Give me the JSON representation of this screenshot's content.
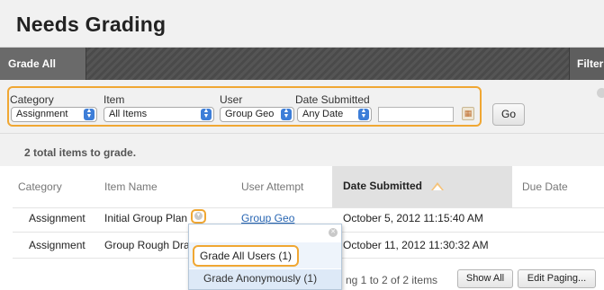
{
  "page": {
    "title": "Needs Grading"
  },
  "action_bar": {
    "grade_all": "Grade All",
    "filter": "Filter"
  },
  "filters": {
    "category": {
      "label": "Category",
      "value": "Assignment"
    },
    "item": {
      "label": "Item",
      "value": "All Items"
    },
    "user": {
      "label": "User",
      "value": "Group Geo"
    },
    "date_submitted": {
      "label": "Date Submitted",
      "value": "Any Date"
    },
    "go": "Go"
  },
  "summary": "2 total items to grade.",
  "table": {
    "headers": [
      "Category",
      "Item Name",
      "User Attempt",
      "Date Submitted",
      "Due Date"
    ],
    "rows": [
      {
        "category": "Assignment",
        "item_name": "Initial Group Plan",
        "user_attempt": "Group Geo",
        "date_submitted": "October 5, 2012 11:15:40 AM"
      },
      {
        "category": "Assignment",
        "item_name": "Group Rough Draf",
        "date_submitted": "October 11, 2012 11:30:32 AM"
      }
    ]
  },
  "context_menu": {
    "items": [
      "Grade All Users (1)",
      "Grade Anonymously (1)"
    ]
  },
  "paging": {
    "info": "ng 1 to 2 of 2 items",
    "show_all": "Show All",
    "edit_paging": "Edit Paging..."
  },
  "colors": {
    "highlight": "#f0a733",
    "link": "#2866b3",
    "select_arrow": "#3d7ed8"
  }
}
